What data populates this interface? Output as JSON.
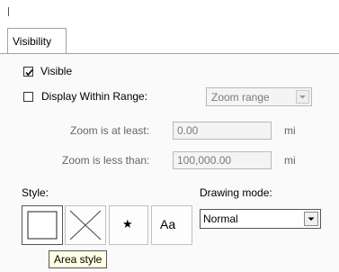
{
  "tabs": [
    {
      "label": "Visibility",
      "selected": true
    }
  ],
  "visibility": {
    "visible": {
      "label": "Visible",
      "checked": true
    },
    "display_within_range": {
      "label": "Display Within Range:",
      "checked": false
    },
    "range_select": {
      "value": "Zoom range",
      "enabled": false
    },
    "zoom_at_least": {
      "label": "Zoom is at least:",
      "value": "0.00",
      "unit": "mi",
      "enabled": false
    },
    "zoom_less_than": {
      "label": "Zoom is less than:",
      "value": "100,000.00",
      "unit": "mi",
      "enabled": false
    }
  },
  "style": {
    "label": "Style:",
    "buttons": [
      {
        "icon": "area-style-icon"
      },
      {
        "icon": "line-style-icon"
      },
      {
        "icon": "symbol-style-icon",
        "glyph": "★"
      },
      {
        "icon": "label-style-icon",
        "text": "Aa"
      }
    ],
    "tooltip": "Area style"
  },
  "drawing_mode": {
    "label": "Drawing mode:",
    "value": "Normal"
  }
}
